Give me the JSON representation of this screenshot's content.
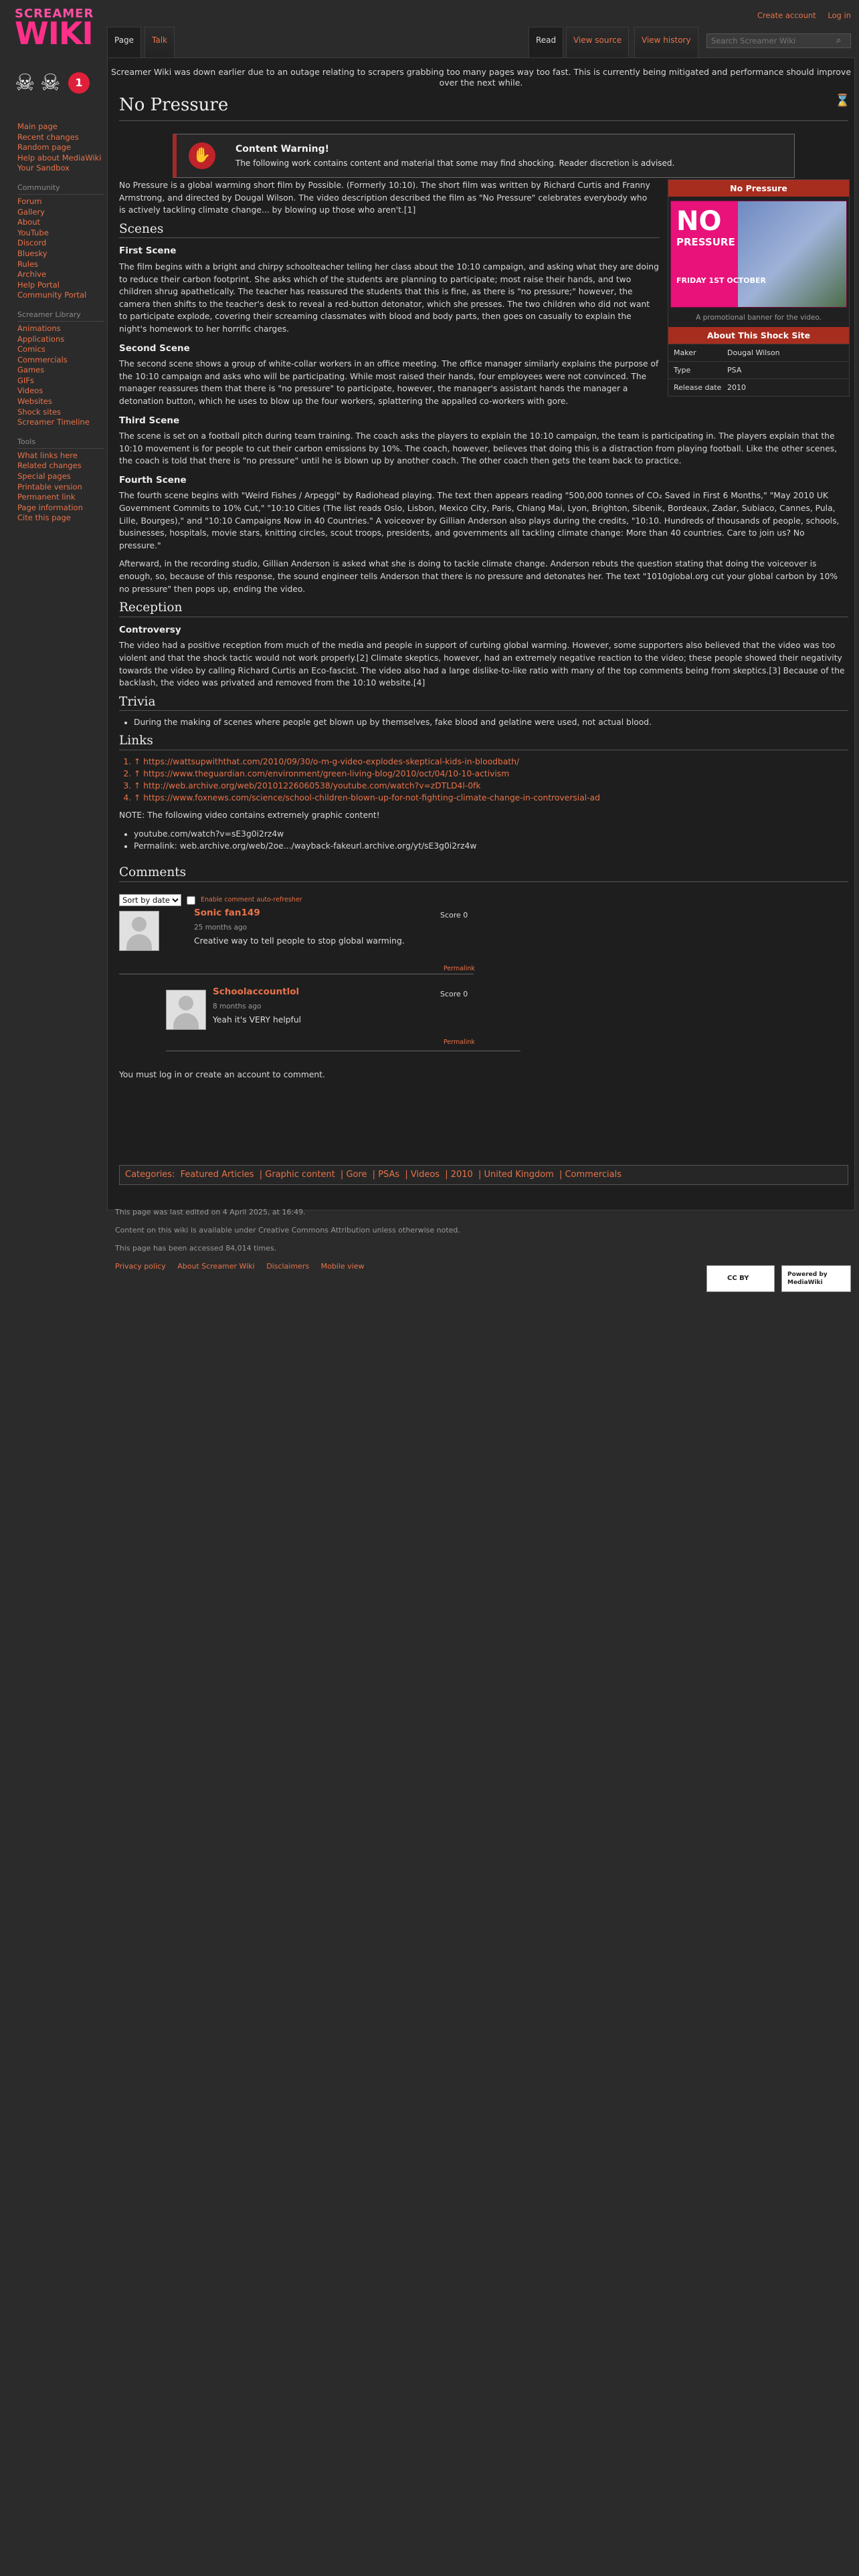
{
  "site": {
    "logo_line1": "SCREAMER",
    "logo_line2": "WIKI",
    "badge": "1"
  },
  "personal": {
    "create_account": "Create account",
    "login": "Log in"
  },
  "tabs": {
    "page": "Page",
    "talk": "Talk",
    "read": "Read",
    "view_source": "View source",
    "view_history": "View history"
  },
  "search": {
    "placeholder": "Search Screamer Wiki"
  },
  "sitenotice": "Screamer Wiki was down earlier due to an outage relating to scrapers grabbing too many pages way too fast. This is currently being mitigated and performance should improve over the next while.",
  "sidebar": {
    "main": [
      "Main page",
      "Recent changes",
      "Random page",
      "Help about MediaWiki",
      "Your Sandbox"
    ],
    "community_head": "Community",
    "community": [
      "Forum",
      "Gallery",
      "About",
      "YouTube",
      "Discord",
      "Bluesky",
      "Rules",
      "Archive",
      "Help Portal",
      "Community Portal"
    ],
    "libraries_head": "Screamer Library",
    "libraries": [
      "Animations",
      "Applications",
      "Comics",
      "Commercials",
      "Games",
      "GIFs",
      "Videos",
      "Websites",
      "Shock sites",
      "Screamer Timeline"
    ],
    "tools_head": "Tools",
    "tools": [
      "What links here",
      "Related changes",
      "Special pages",
      "Printable version",
      "Permanent link",
      "Page information",
      "Cite this page"
    ]
  },
  "page": {
    "title": "No Pressure",
    "warning_title": "Content Warning!",
    "warning_text": "The following work contains content and material that some may find shocking. Reader discretion is advised.",
    "lede": "No Pressure is a global warming short film by Possible. (Formerly 10:10). The short film was written by Richard Curtis and Franny Armstrong, and directed by Dougal Wilson. The video description described the film as \"No Pressure\" celebrates everybody who is actively tackling climate change... by blowing up those who aren't.[1]",
    "scenes_head": "Scenes",
    "first_scene_head": "First Scene",
    "first_scene": "The film begins with a bright and chirpy schoolteacher telling her class about the 10:10 campaign, and asking what they are doing to reduce their carbon footprint. She asks which of the students are planning to participate; most raise their hands, and two children shrug apathetically. The teacher has reassured the students that this is fine, as there is \"no pressure;\" however, the camera then shifts to the teacher's desk to reveal a red-button detonator, which she presses. The two children who did not want to participate explode, covering their screaming classmates with blood and body parts, then goes on casually to explain the night's homework to her horrific charges.",
    "second_scene_head": "Second Scene",
    "second_scene": "The second scene shows a group of white-collar workers in an office meeting. The office manager similarly explains the purpose of the 10:10 campaign and asks who will be participating. While most raised their hands, four employees were not convinced. The manager reassures them that there is \"no pressure\" to participate, however, the manager's assistant hands the manager a detonation button, which he uses to blow up the four workers, splattering the appalled co-workers with gore.",
    "third_scene_head": "Third Scene",
    "third_scene": "The scene is set on a football pitch during team training. The coach asks the players to explain the 10:10 campaign, the team is participating in. The players explain that the 10:10 movement is for people to cut their carbon emissions by 10%. The coach, however, believes that doing this is a distraction from playing football. Like the other scenes, the coach is told that there is \"no pressure\" until he is blown up by another coach. The other coach then gets the team back to practice.",
    "fourth_scene_head": "Fourth Scene",
    "fourth_scene_1": "The fourth scene begins with \"Weird Fishes / Arpeggi\" by Radiohead playing. The text then appears reading \"500,000 tonnes of CO₂ Saved in First 6 Months,\" \"May 2010 UK Government Commits to 10% Cut,\" \"10:10 Cities (The list reads Oslo, Lisbon, Mexico City, Paris, Chiang Mai, Lyon, Brighton, Sibenik, Bordeaux, Zadar, Subiaco, Cannes, Pula, Lille, Bourges),\" and \"10:10 Campaigns Now in 40 Countries.\" A voiceover by Gillian Anderson also plays during the credits, \"10:10. Hundreds of thousands of people, schools, businesses, hospitals, movie stars, knitting circles, scout troops, presidents, and governments all tackling climate change: More than 40 countries. Care to join us? No pressure.\"",
    "fourth_scene_2": "Afterward, in the recording studio, Gillian Anderson is asked what she is doing to tackle climate change. Anderson rebuts the question stating that doing the voiceover is enough, so, because of this response, the sound engineer tells Anderson that there is no pressure and detonates her. The text \"1010global.org cut your global carbon by 10% no pressure\" then pops up, ending the video.",
    "reception_head": "Reception",
    "controversy_head": "Controversy",
    "controversy": "The video had a positive reception from much of the media and people in support of curbing global warming. However, some supporters also believed that the video was too violent and that the shock tactic would not work properly.[2] Climate skeptics, however, had an extremely negative reaction to the video; these people showed their negativity towards the video by calling Richard Curtis an Eco-fascist. The video also had a large dislike-to-like ratio with many of the top comments being from skeptics.[3] Because of the backlash, the video was privated and removed from the 10:10 website.[4]",
    "trivia_head": "Trivia",
    "trivia": [
      "During the making of scenes where people get blown up by themselves, fake blood and gelatine were used, not actual blood."
    ],
    "links_head": "Links",
    "links": [
      "↑ https://wattsupwiththat.com/2010/09/30/o-m-g-video-explodes-skeptical-kids-in-bloodbath/",
      "↑ https://www.theguardian.com/environment/green-living-blog/2010/oct/04/10-10-activism",
      "↑ http://web.archive.org/web/20101226060538/youtube.com/watch?v=zDTLD4l-0fk",
      "↑ https://www.foxnews.com/science/school-children-blown-up-for-not-fighting-climate-change-in-controversial-ad"
    ],
    "note": "NOTE: The following video contains extremely graphic content!",
    "video_items": [
      "youtube.com/watch?v=sE3g0i2rz4w",
      "Permalink: web.archive.org/web/2oe.../wayback-fakeurl.archive.org/yt/sE3g0i2rz4w"
    ]
  },
  "infobox": {
    "title": "No Pressure",
    "poster_word": "NO",
    "poster_word2": "PRESSURE",
    "poster_date": "FRIDAY 1ST OCTOBER",
    "caption": "A promotional banner for the video.",
    "about_head": "About This Shock Site",
    "rows": [
      {
        "k": "Maker",
        "v": "Dougal Wilson"
      },
      {
        "k": "Type",
        "v": "PSA"
      },
      {
        "k": "Release date",
        "v": "2010"
      }
    ]
  },
  "comments": {
    "head": "Comments",
    "sort_label": "Sort by date",
    "autorefresh": "Enable comment auto-refresher",
    "items": [
      {
        "user": "Sonic fan149",
        "time": "25 months ago",
        "text": "Creative way to tell people to stop global warming.",
        "score": "Score 0",
        "permalink": "Permalink"
      },
      {
        "user": "Schoolaccountlol",
        "time": "8 months ago",
        "text": "Yeah it's VERY helpful",
        "score": "Score 0",
        "permalink": "Permalink"
      }
    ],
    "login_note": "You must log in or create an account to comment."
  },
  "categories": {
    "label": "Categories:",
    "items": [
      "Featured Articles",
      "Graphic content",
      "Gore",
      "PSAs",
      "Videos",
      "2010",
      "United Kingdom",
      "Commercials"
    ]
  },
  "footer": {
    "last_edited": "This page was last edited on 4 April 2025, at 16:49.",
    "license": "Content on this wiki is available under Creative Commons Attribution unless otherwise noted.",
    "accessed": "This page has been accessed 84,014 times.",
    "links": [
      "Privacy policy",
      "About Screamer Wiki",
      "Disclaimers",
      "Mobile view"
    ],
    "cc_badge": "CC BY",
    "mw_badge": "Powered by MediaWiki"
  }
}
